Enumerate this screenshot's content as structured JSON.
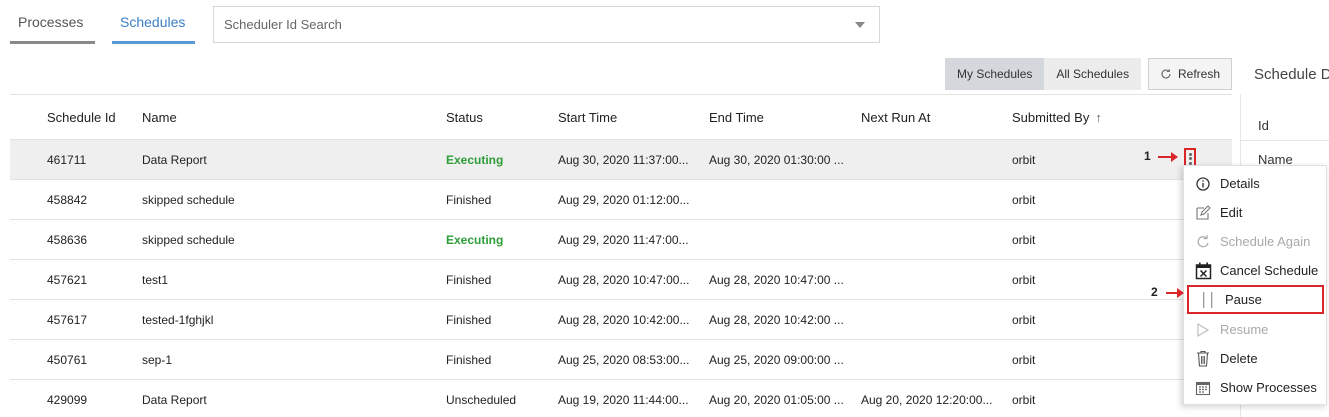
{
  "tabs": [
    {
      "label": "Processes",
      "active": false
    },
    {
      "label": "Schedules",
      "active": true
    }
  ],
  "search": {
    "placeholder": "Scheduler Id Search"
  },
  "filters": {
    "my_schedules": "My Schedules",
    "all_schedules": "All Schedules",
    "refresh": "Refresh"
  },
  "side_panel": {
    "title": "Schedule Details",
    "id_label": "Id",
    "name_label": "Name"
  },
  "table": {
    "columns": [
      "Schedule Id",
      "Name",
      "Status",
      "Start Time",
      "End Time",
      "Next Run At",
      "Submitted By"
    ],
    "sort_column": "Submitted By",
    "rows": [
      {
        "id": "461711",
        "name": "Data Report",
        "status": "Executing",
        "start": "Aug 30, 2020 11:37:00...",
        "end": "Aug 30, 2020 01:30:00 ...",
        "next": "",
        "submitted_by": "orbit"
      },
      {
        "id": "458842",
        "name": " skipped schedule",
        "status": "Finished",
        "start": "Aug 29, 2020 01:12:00...",
        "end": "",
        "next": "",
        "submitted_by": "orbit"
      },
      {
        "id": "458636",
        "name": " skipped schedule",
        "status": "Executing",
        "start": "Aug 29, 2020 11:47:00...",
        "end": "",
        "next": "",
        "submitted_by": "orbit"
      },
      {
        "id": "457621",
        "name": "test1",
        "status": "Finished",
        "start": "Aug 28, 2020 10:47:00...",
        "end": "Aug 28, 2020 10:47:00 ...",
        "next": "",
        "submitted_by": "orbit"
      },
      {
        "id": "457617",
        "name": "tested-1fghjkl",
        "status": "Finished",
        "start": "Aug 28, 2020 10:42:00...",
        "end": "Aug 28, 2020 10:42:00 ...",
        "next": "",
        "submitted_by": "orbit"
      },
      {
        "id": "450761",
        "name": "sep-1",
        "status": "Finished",
        "start": "Aug 25, 2020 08:53:00...",
        "end": "Aug 25, 2020 09:00:00 ...",
        "next": "",
        "submitted_by": "orbit"
      },
      {
        "id": "429099",
        "name": "Data Report",
        "status": "Unscheduled",
        "start": "Aug 19, 2020 11:44:00...",
        "end": "Aug 20, 2020 01:05:00 ...",
        "next": "Aug 20, 2020 12:20:00...",
        "submitted_by": "orbit"
      }
    ]
  },
  "annotations": {
    "step1": "1",
    "step2": "2"
  },
  "context_menu": {
    "items": [
      {
        "label": "Details",
        "icon": "info-icon",
        "disabled": false
      },
      {
        "label": "Edit",
        "icon": "edit-icon",
        "disabled": false
      },
      {
        "label": "Schedule Again",
        "icon": "redo-icon",
        "disabled": true
      },
      {
        "label": "Cancel Schedule",
        "icon": "calendar-cancel-icon",
        "disabled": false
      },
      {
        "label": "Pause",
        "icon": "pause-icon",
        "disabled": false
      },
      {
        "label": "Resume",
        "icon": "play-icon",
        "disabled": true
      },
      {
        "label": "Delete",
        "icon": "trash-icon",
        "disabled": false
      },
      {
        "label": "Show Processes",
        "icon": "calendar-icon",
        "disabled": false
      }
    ]
  },
  "colors": {
    "executing": "#2e9c38",
    "accent": "#3a7fc4",
    "highlight": "#d9262b"
  }
}
